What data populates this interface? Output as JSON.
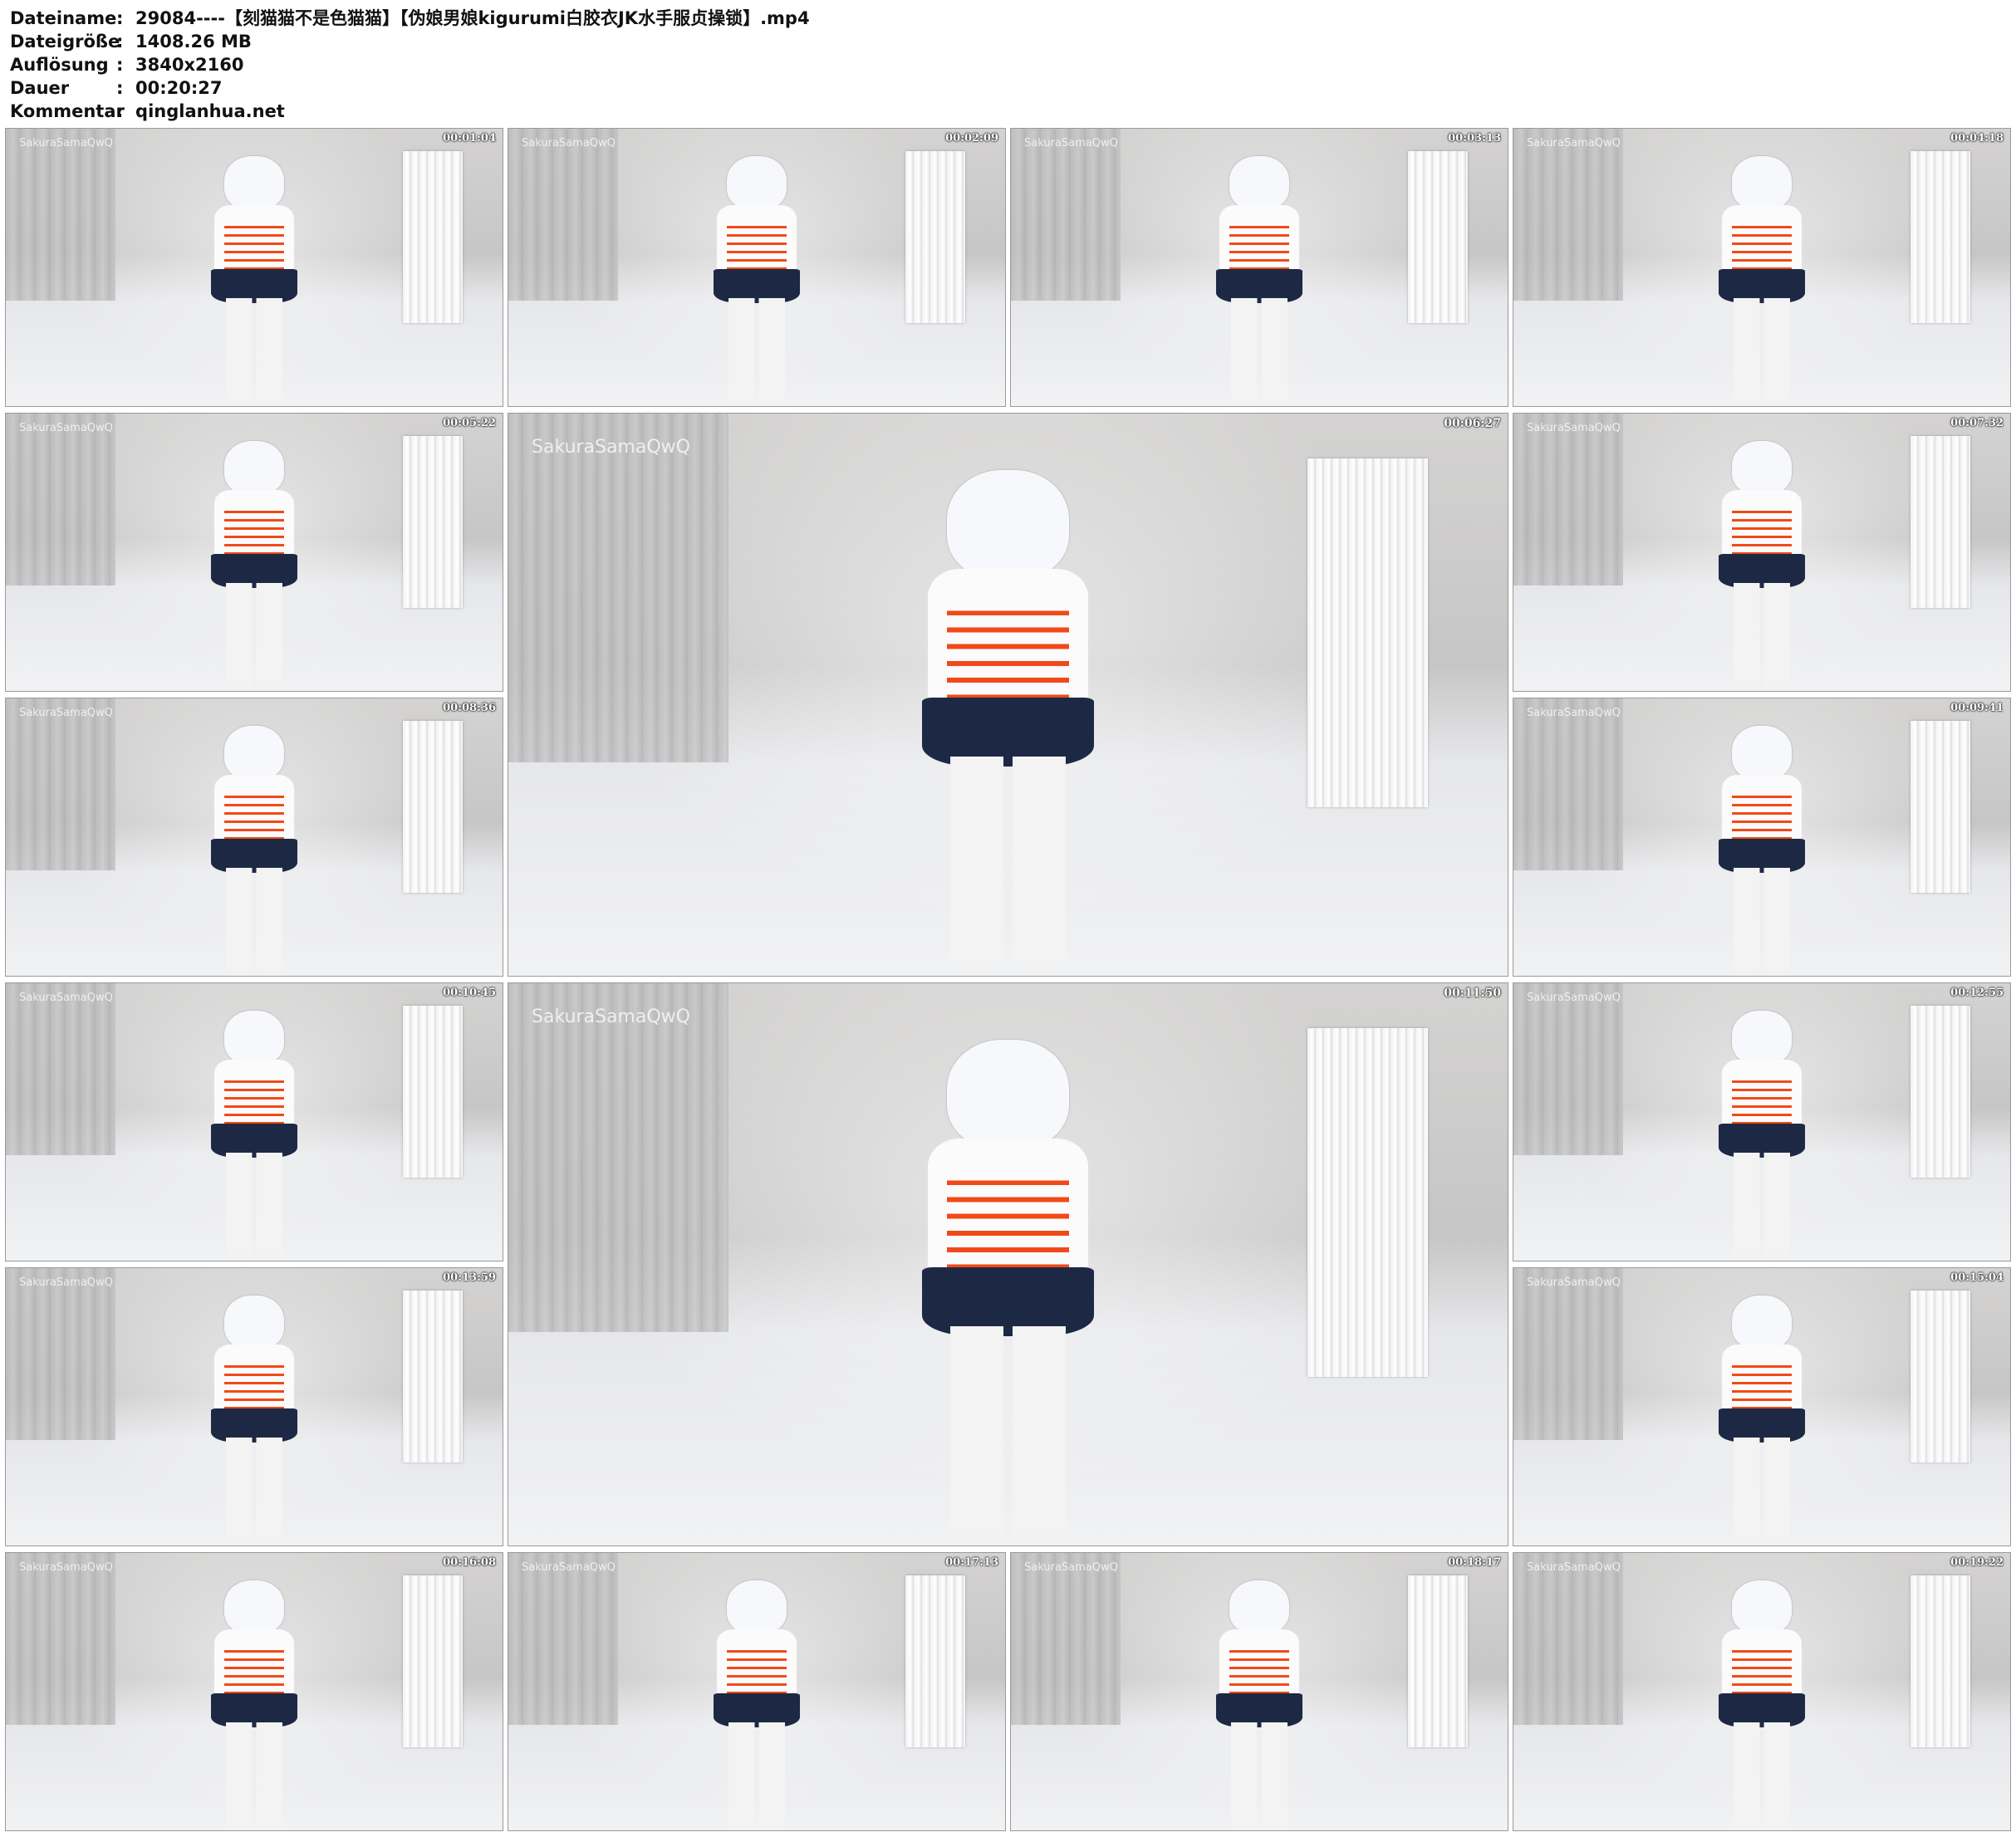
{
  "header": {
    "rows": [
      {
        "key": "Dateiname",
        "value": "29084----【刻猫猫不是色猫猫】【伪娘男娘kigurumi白胶衣JK水手服贞操锁】.mp4"
      },
      {
        "key": "Dateigröße",
        "value": "1408.26 MB"
      },
      {
        "key": "Auflösung",
        "value": "3840x2160"
      },
      {
        "key": "Dauer",
        "value": "00:20:27"
      },
      {
        "key": "Kommentar",
        "value": "qinglanhua.net"
      }
    ],
    "separator": ":"
  },
  "thumbnails": [
    {
      "timestamp": "00:01:04",
      "watermark": "SakuraSamaQwQ"
    },
    {
      "timestamp": "00:02:09",
      "watermark": "SakuraSamaQwQ"
    },
    {
      "timestamp": "00:03:13",
      "watermark": "SakuraSamaQwQ"
    },
    {
      "timestamp": "00:04:18",
      "watermark": "SakuraSamaQwQ"
    },
    {
      "timestamp": "00:05:22",
      "watermark": "SakuraSamaQwQ"
    },
    {
      "timestamp": "00:06:27",
      "watermark": "SakuraSamaQwQ"
    },
    {
      "timestamp": "00:07:32",
      "watermark": "SakuraSamaQwQ"
    },
    {
      "timestamp": "00:08:36",
      "watermark": "SakuraSamaQwQ"
    },
    {
      "timestamp": "00:09:41",
      "watermark": "SakuraSamaQwQ"
    },
    {
      "timestamp": "00:10:45",
      "watermark": "SakuraSamaQwQ"
    },
    {
      "timestamp": "00:11:50",
      "watermark": "SakuraSamaQwQ"
    },
    {
      "timestamp": "00:12:55",
      "watermark": "SakuraSamaQwQ"
    },
    {
      "timestamp": "00:13:59",
      "watermark": "SakuraSamaQwQ"
    },
    {
      "timestamp": "00:15:04",
      "watermark": "SakuraSamaQwQ"
    },
    {
      "timestamp": "00:16:08",
      "watermark": "SakuraSamaQwQ"
    },
    {
      "timestamp": "00:17:13",
      "watermark": "SakuraSamaQwQ"
    },
    {
      "timestamp": "00:18:17",
      "watermark": "SakuraSamaQwQ"
    },
    {
      "timestamp": "00:19:22",
      "watermark": "SakuraSamaQwQ"
    }
  ]
}
